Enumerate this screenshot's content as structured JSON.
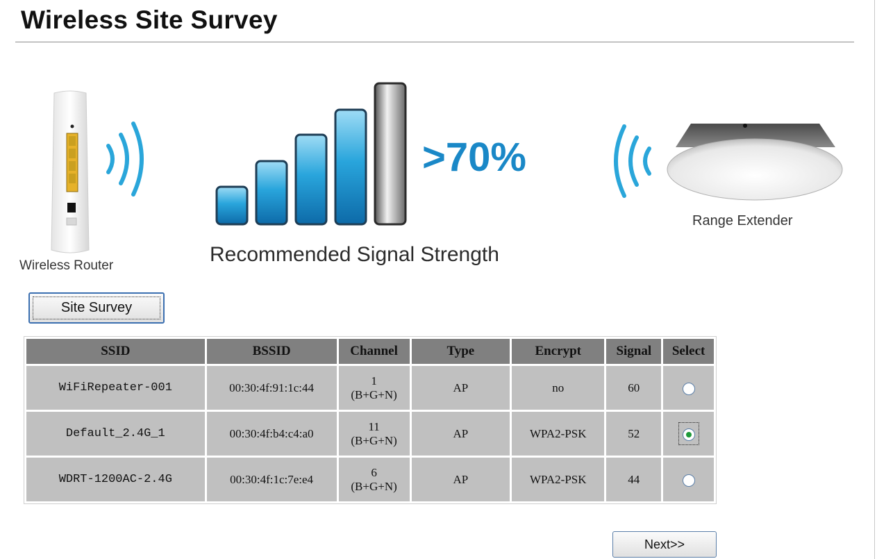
{
  "page": {
    "title": "Wireless Site Survey"
  },
  "illustration": {
    "router_caption": "Wireless Router",
    "extender_caption": "Range Extender",
    "signal_percent": ">70%",
    "signal_caption": "Recommended Signal Strength",
    "colors": {
      "accent": "#1a88c7",
      "wave": "#2aa6da"
    }
  },
  "buttons": {
    "site_survey": "Site Survey",
    "next": "Next>>"
  },
  "table": {
    "headers": [
      "SSID",
      "BSSID",
      "Channel",
      "Type",
      "Encrypt",
      "Signal",
      "Select"
    ],
    "rows": [
      {
        "ssid": "WiFiRepeater-001",
        "bssid": "00:30:4f:91:1c:44",
        "channel": "1",
        "mode": "(B+G+N)",
        "type": "AP",
        "encrypt": "no",
        "signal": "60",
        "selected": false
      },
      {
        "ssid": "Default_2.4G_1",
        "bssid": "00:30:4f:b4:c4:a0",
        "channel": "11",
        "mode": "(B+G+N)",
        "type": "AP",
        "encrypt": "WPA2-PSK",
        "signal": "52",
        "selected": true
      },
      {
        "ssid": "WDRT-1200AC-2.4G",
        "bssid": "00:30:4f:1c:7e:e4",
        "channel": "6",
        "mode": "(B+G+N)",
        "type": "AP",
        "encrypt": "WPA2-PSK",
        "signal": "44",
        "selected": false
      }
    ]
  }
}
